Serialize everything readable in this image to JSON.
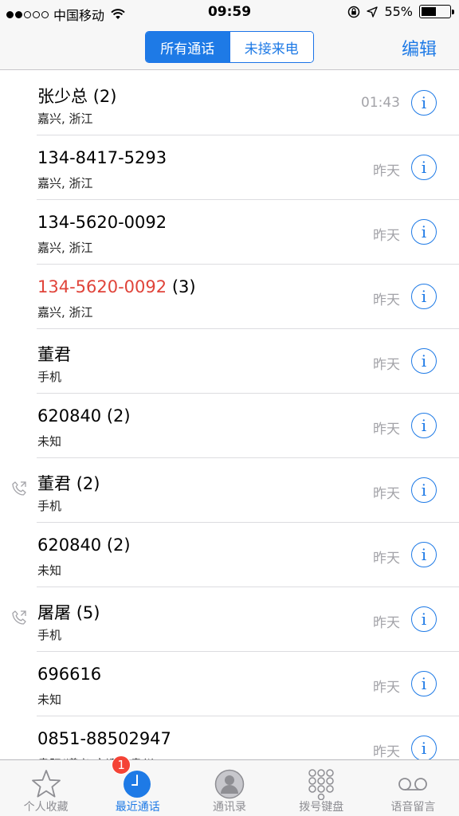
{
  "status_bar": {
    "carrier": "中国移动",
    "time": "09:59",
    "battery": "55%",
    "battery_level": 0.55
  },
  "nav": {
    "segments": [
      "所有通话",
      "未接来电"
    ],
    "edit": "编辑"
  },
  "calls": [
    {
      "name": "张少总",
      "count": "(2)",
      "sub": "嘉兴, 浙江",
      "time": "01:43",
      "missed": false,
      "outgoing": false
    },
    {
      "name": "134-8417-5293",
      "count": "",
      "sub": "嘉兴, 浙江",
      "time": "昨天",
      "missed": false,
      "outgoing": false
    },
    {
      "name": "134-5620-0092",
      "count": "",
      "sub": "嘉兴, 浙江",
      "time": "昨天",
      "missed": false,
      "outgoing": false
    },
    {
      "name": "134-5620-0092",
      "count": "(3)",
      "sub": "嘉兴, 浙江",
      "time": "昨天",
      "missed": true,
      "outgoing": false
    },
    {
      "name": "董君",
      "count": "",
      "sub": "手机",
      "time": "昨天",
      "missed": false,
      "outgoing": false
    },
    {
      "name": "620840",
      "count": "(2)",
      "sub": "未知",
      "time": "昨天",
      "missed": false,
      "outgoing": false
    },
    {
      "name": "董君",
      "count": "(2)",
      "sub": "手机",
      "time": "昨天",
      "missed": false,
      "outgoing": true
    },
    {
      "name": "620840",
      "count": "(2)",
      "sub": "未知",
      "time": "昨天",
      "missed": false,
      "outgoing": false
    },
    {
      "name": "屠屠",
      "count": "(5)",
      "sub": "手机",
      "time": "昨天",
      "missed": false,
      "outgoing": true
    },
    {
      "name": "696616",
      "count": "",
      "sub": "未知",
      "time": "昨天",
      "missed": false,
      "outgoing": false
    },
    {
      "name": "0851-88502947",
      "count": "",
      "sub": "贵阳(遵义/安顺), 贵州",
      "time": "昨天",
      "missed": false,
      "outgoing": false
    }
  ],
  "info_glyph": "i",
  "tabs": [
    {
      "label": "个人收藏",
      "icon": "star-icon",
      "active": false
    },
    {
      "label": "最近通话",
      "icon": "clock-icon",
      "active": true,
      "badge": "1"
    },
    {
      "label": "通讯录",
      "icon": "contacts-icon",
      "active": false
    },
    {
      "label": "拨号键盘",
      "icon": "keypad-icon",
      "active": false
    },
    {
      "label": "语音留言",
      "icon": "voicemail-icon",
      "active": false
    }
  ],
  "colors": {
    "accent": "#1e7ae6",
    "missed": "#e0443a",
    "secondary": "#a3a3a8",
    "badge": "#f44336"
  }
}
